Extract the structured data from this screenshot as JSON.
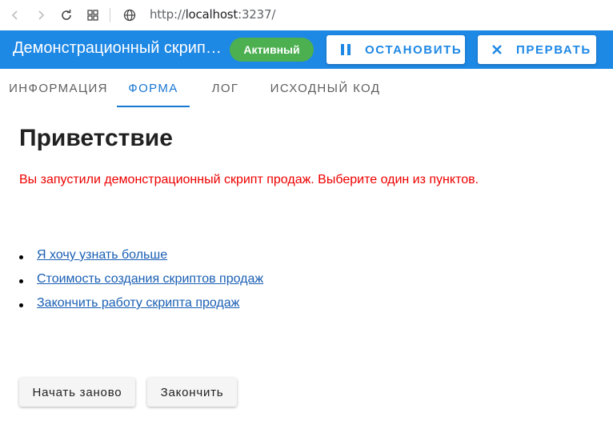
{
  "browser": {
    "url_scheme": "http://",
    "url_host": "localhost",
    "url_rest": ":3237/",
    "icons": [
      "back-icon",
      "forward-icon",
      "reload-icon",
      "apps-icon",
      "globe-icon"
    ]
  },
  "header": {
    "title": "Демонстрационный скрипт продаж",
    "status": "Активный",
    "stop_label": "ОСТАНОВИТЬ",
    "abort_label": "ПРЕРВАТЬ",
    "colors": {
      "bar": "#1e88e5",
      "status": "#4caf50"
    }
  },
  "tabs": [
    {
      "label": "ИНФОРМАЦИЯ"
    },
    {
      "label": "ФОРМА"
    },
    {
      "label": "ЛОГ"
    },
    {
      "label": "ИСХОДНЫЙ КОД"
    }
  ],
  "tabs_active": "ФОРМА",
  "form": {
    "heading": "Приветствие",
    "notice": "Вы запустили демонстрационный скрипт продаж. Выберите один из пунктов.",
    "choices": [
      "Я хочу узнать больше",
      "Стоимость создания скриптов продаж",
      "Закончить работу скрипта продаж"
    ],
    "restart_label": "Начать заново",
    "finish_label": "Закончить"
  }
}
